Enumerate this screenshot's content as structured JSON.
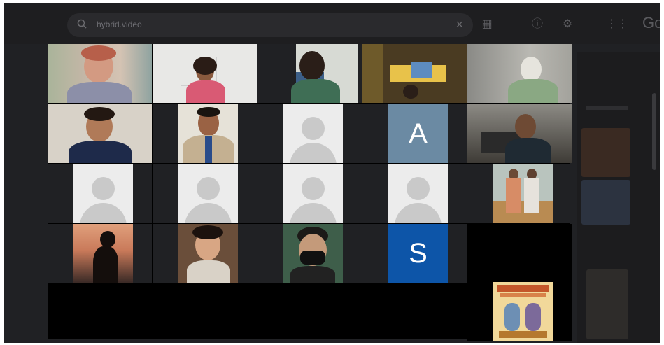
{
  "browser": {
    "search_text": "hybrid.video",
    "brand_text": "Go",
    "icons": [
      "search-icon",
      "clear-icon",
      "grid-icon",
      "help-icon",
      "settings-icon",
      "apps-icon"
    ]
  },
  "participants": [
    {
      "row": 1,
      "col": 1,
      "kind": "video"
    },
    {
      "row": 1,
      "col": 2,
      "kind": "video"
    },
    {
      "row": 1,
      "col": 3,
      "kind": "video"
    },
    {
      "row": 1,
      "col": 4,
      "kind": "video"
    },
    {
      "row": 1,
      "col": 5,
      "kind": "video"
    },
    {
      "row": 2,
      "col": 1,
      "kind": "video"
    },
    {
      "row": 2,
      "col": 2,
      "kind": "video"
    },
    {
      "row": 2,
      "col": 3,
      "kind": "placeholder"
    },
    {
      "row": 2,
      "col": 4,
      "kind": "initial",
      "initial": "A",
      "color": "#6b8aa3"
    },
    {
      "row": 2,
      "col": 5,
      "kind": "video"
    },
    {
      "row": 3,
      "col": 1,
      "kind": "placeholder"
    },
    {
      "row": 3,
      "col": 2,
      "kind": "placeholder"
    },
    {
      "row": 3,
      "col": 3,
      "kind": "placeholder"
    },
    {
      "row": 3,
      "col": 4,
      "kind": "placeholder"
    },
    {
      "row": 3,
      "col": 5,
      "kind": "video"
    },
    {
      "row": 4,
      "col": 1,
      "kind": "video"
    },
    {
      "row": 4,
      "col": 2,
      "kind": "video"
    },
    {
      "row": 4,
      "col": 3,
      "kind": "video"
    },
    {
      "row": 4,
      "col": 4,
      "kind": "initial",
      "initial": "S",
      "color": "#0d55a8"
    },
    {
      "row": 5,
      "col": 5,
      "kind": "logo"
    }
  ],
  "tiles": {
    "a_initial": "A",
    "s_initial": "S"
  },
  "colors": {
    "background": "#000000",
    "placeholder_card": "#ececec",
    "avatar_shape": "#c9c9c9",
    "tile_a": "#6b8aa3",
    "tile_s": "#0d55a8"
  }
}
